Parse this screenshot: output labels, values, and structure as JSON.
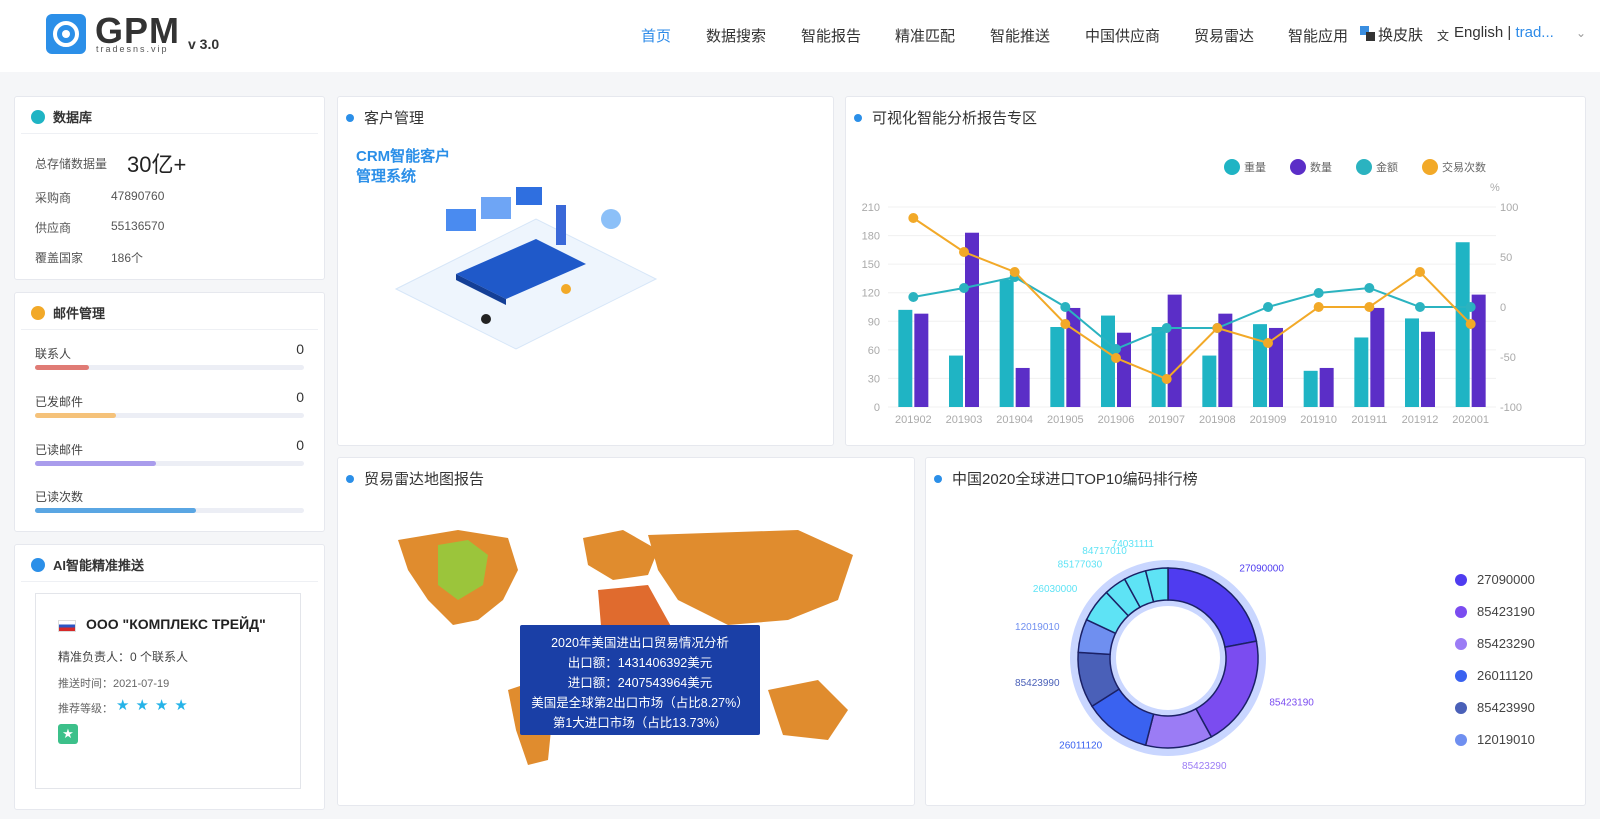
{
  "header": {
    "logo_text": "GPM",
    "logo_subtitle": "tradesns.vip",
    "version": "v 3.0",
    "nav": [
      "首页",
      "数据搜索",
      "智能报告",
      "精准匹配",
      "智能推送",
      "中国供应商",
      "贸易雷达",
      "智能应用"
    ],
    "skin_label": "换皮肤",
    "language": "English",
    "separator": "|",
    "user": "trad..."
  },
  "database": {
    "title": "数据库",
    "total_label": "总存储数据量",
    "total_value": "30亿+",
    "rows": [
      {
        "label": "采购商",
        "value": "47890760"
      },
      {
        "label": "供应商",
        "value": "55136570"
      },
      {
        "label": "覆盖国家",
        "value": "186个"
      }
    ]
  },
  "mail": {
    "title": "邮件管理",
    "rows": [
      {
        "label": "联系人",
        "value": "0",
        "fill": 0.2,
        "color": "#e07b75"
      },
      {
        "label": "已发邮件",
        "value": "0",
        "fill": 0.3,
        "color": "#f5c27a"
      },
      {
        "label": "已读邮件",
        "value": "0",
        "fill": 0.45,
        "color": "#a99cec"
      },
      {
        "label": "已读次数",
        "value": "",
        "fill": 0.6,
        "color": "#5aa6e3"
      }
    ]
  },
  "push": {
    "title": "AI智能精准推送",
    "company": "ООО \"КОМПЛЕКС ТРЕЙД\"",
    "owner": "精准负责人：0 个联系人",
    "time": "推送时间：2021-07-19",
    "level_label": "推荐等级：",
    "stars": 4
  },
  "crm": {
    "title": "客户管理",
    "heading_line1": "CRM智能客户",
    "heading_line2": "管理系统"
  },
  "report": {
    "title": "可视化智能分析报告专区"
  },
  "map": {
    "title": "贸易雷达地图报告",
    "tooltip": [
      "2020年美国进出口贸易情况分析",
      "出口额：1431406392美元",
      "进口额：2407543964美元",
      "美国是全球第2出口市场（占比8.27%）",
      "第1大进口市场（占比13.73%）"
    ]
  },
  "ranking": {
    "title": "中国2020全球进口TOP10编码排行榜",
    "legend": [
      "27090000",
      "85423190",
      "85423290",
      "26011120",
      "85423990",
      "12019010"
    ],
    "legend_colors": [
      "#4f3cf0",
      "#7b4cf0",
      "#9b7cf5",
      "#3a62f0",
      "#4a60b8",
      "#6f8ff0"
    ],
    "labels": [
      "74031111",
      "84717010",
      "85177030",
      "26030000",
      "12019010",
      "85423990",
      "26011120",
      "85423290",
      "85423190",
      "27090000"
    ]
  },
  "chart_data": {
    "type": "bar",
    "categories": [
      "201902",
      "201903",
      "201904",
      "201905",
      "201906",
      "201907",
      "201908",
      "201909",
      "201910",
      "201911",
      "201912",
      "202001"
    ],
    "series": [
      {
        "name": "重量",
        "type": "bar",
        "color": "#1fb4c4",
        "values": [
          102,
          54,
          134,
          84,
          96,
          84,
          54,
          87,
          38,
          73,
          93,
          173
        ]
      },
      {
        "name": "数量",
        "type": "bar",
        "color": "#5b2ec7",
        "values": [
          98,
          183,
          41,
          104,
          78,
          118,
          98,
          83,
          41,
          104,
          79,
          118
        ]
      },
      {
        "name": "金额",
        "type": "line",
        "axis": "right",
        "color": "#2bb3c0",
        "values": [
          10,
          19,
          30,
          0,
          -42,
          -21,
          -21,
          0,
          14,
          19,
          0,
          0
        ]
      },
      {
        "name": "交易次数",
        "type": "line",
        "axis": "right",
        "color": "#f2a928",
        "values": [
          89,
          55,
          35,
          -17,
          -51,
          -72,
          -21,
          -36,
          0,
          0,
          35,
          -17
        ]
      }
    ],
    "ylim": [
      0,
      210
    ],
    "yticks": [
      0,
      30,
      60,
      90,
      120,
      150,
      180,
      210
    ],
    "y2lim": [
      -100,
      100
    ],
    "y2ticks": [
      -100,
      -50,
      0,
      50,
      100
    ],
    "y2label": "%",
    "legend_position": "top-right"
  }
}
